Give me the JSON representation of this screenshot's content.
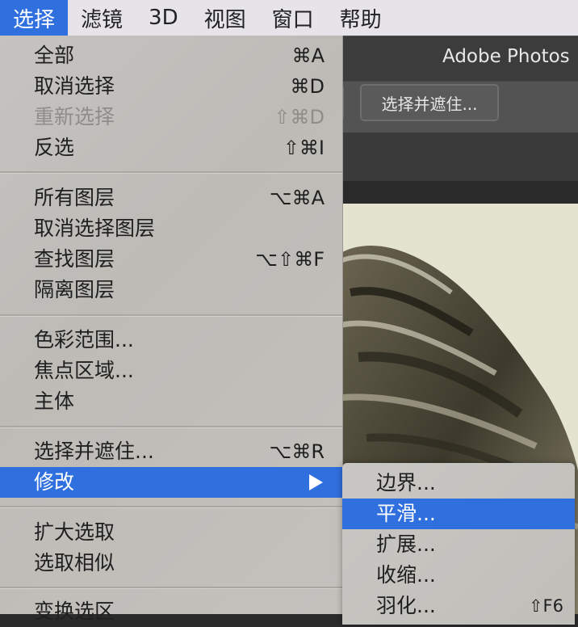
{
  "menubar": {
    "items": [
      {
        "label": "选择",
        "active": true
      },
      {
        "label": "滤镜"
      },
      {
        "label": "3D"
      },
      {
        "label": "视图"
      },
      {
        "label": "窗口"
      },
      {
        "label": "帮助"
      }
    ]
  },
  "app": {
    "title": "Adobe Photos",
    "select_mask_button": "选择并遮住..."
  },
  "select_menu": {
    "items": [
      {
        "label": "全部",
        "shortcut": "⌘A"
      },
      {
        "label": "取消选择",
        "shortcut": "⌘D"
      },
      {
        "label": "重新选择",
        "shortcut": "⇧⌘D",
        "disabled": true
      },
      {
        "label": "反选",
        "shortcut": "⇧⌘I"
      },
      {
        "label": "所有图层",
        "shortcut": "⌥⌘A"
      },
      {
        "label": "取消选择图层",
        "shortcut": ""
      },
      {
        "label": "查找图层",
        "shortcut": "⌥⇧⌘F"
      },
      {
        "label": "隔离图层",
        "shortcut": ""
      },
      {
        "label": "色彩范围...",
        "shortcut": ""
      },
      {
        "label": "焦点区域...",
        "shortcut": ""
      },
      {
        "label": "主体",
        "shortcut": ""
      },
      {
        "label": "选择并遮住...",
        "shortcut": "⌥⌘R"
      },
      {
        "label": "修改",
        "shortcut": "",
        "highlighted": true,
        "submenu": true
      },
      {
        "label": "扩大选取",
        "shortcut": ""
      },
      {
        "label": "选取相似",
        "shortcut": ""
      },
      {
        "label": "变换选区",
        "shortcut": ""
      }
    ]
  },
  "modify_submenu": {
    "items": [
      {
        "label": "边界...",
        "shortcut": ""
      },
      {
        "label": "平滑...",
        "shortcut": "",
        "highlighted": true
      },
      {
        "label": "扩展...",
        "shortcut": ""
      },
      {
        "label": "收缩...",
        "shortcut": ""
      },
      {
        "label": "羽化...",
        "shortcut": "⇧F6"
      }
    ]
  },
  "colors": {
    "highlight": "#2f6fde",
    "menu_bg": "#c2c0bb",
    "chrome_dark": "#3c3c3c"
  }
}
